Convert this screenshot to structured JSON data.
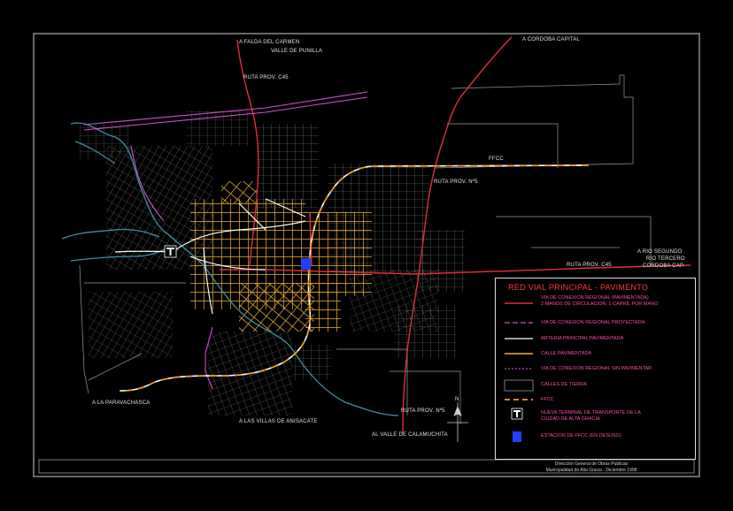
{
  "labels": {
    "to_falda": "A FALDA DEL CARMEN",
    "to_falda_2": "VALLE DE PUNILLA",
    "to_cordoba": "A CORDOBA CAPITAL",
    "ruta_c45_top": "RUTA PROV. C45",
    "ruta_5": "RUTA PROV. Nº5",
    "ffcc": "FFCC",
    "to_rio_segundo": "A RIO SEGUNDO",
    "to_rio_tercero": "RIO TERCERO",
    "to_cordoba_caf": "CORDOBA CAP.",
    "ruta_c45_right": "RUTA PROV. C45",
    "to_paravachasca": "A LA PARAVACHASCA",
    "to_villas": "A LAS VILLAS DE ANISACATE",
    "ruta_5_south": "RUTA PROV. Nº5",
    "to_calamuchita": "AL VALLE DE CALAMUCHITA",
    "north": "N"
  },
  "legend": {
    "title": "RED VIAL PRINCIPAL - PAVIMENTO",
    "items": [
      {
        "icon": "red-line",
        "color": "#e0303a",
        "text": "VIA DE CONEXION REGIONAL (PAVIMENTADA)\n2 MANOS DE CIRCULACION, 1 CARRIL POR MANO"
      },
      {
        "icon": "magenta-dashed-line",
        "color": "#d050d0",
        "text": "VIA DE CONEXION REGIONAL PROYECTADA"
      },
      {
        "icon": "white-line",
        "color": "#ffffff",
        "text": "ARTERIA PRINCIPAL PAVIMENTADA"
      },
      {
        "icon": "yellow-line",
        "color": "#f0b030",
        "text": "CALLE PAVIMENTADA"
      },
      {
        "icon": "magenta-dotted-line",
        "color": "#c050c0",
        "text": "VIA DE CONEXION REGIONAL SIN PAVIMENTAR"
      },
      {
        "icon": "gray-streets",
        "color": "#9a9a9a",
        "text": "CALLES DE TIERRA"
      },
      {
        "icon": "railway-dashed",
        "color": "#f0a020",
        "text": "FFCC"
      },
      {
        "icon": "terminal-t-icon",
        "color": "#ffffff",
        "text": "NUEVA TERMINAL DE TRANSPORTE DE LA\nCIUDAD DE ALTA GRACIA"
      },
      {
        "icon": "station-square-icon",
        "color": "#2040ff",
        "text": "ESTACION DE FFCC (EN DESUSO)"
      }
    ]
  },
  "credits": {
    "line1": "Dirección General de Obras Públicas",
    "line2": "Municipalidad de Alta Gracia - Diciembre 1998"
  },
  "colors": {
    "regional_paved": "#e0303a",
    "regional_projected": "#d050d0",
    "paved_street": "#f0b030",
    "dirt_street": "#9a9a9a",
    "river": "#3f8fa8",
    "railway": "#f0a020",
    "station": "#2040ff"
  }
}
